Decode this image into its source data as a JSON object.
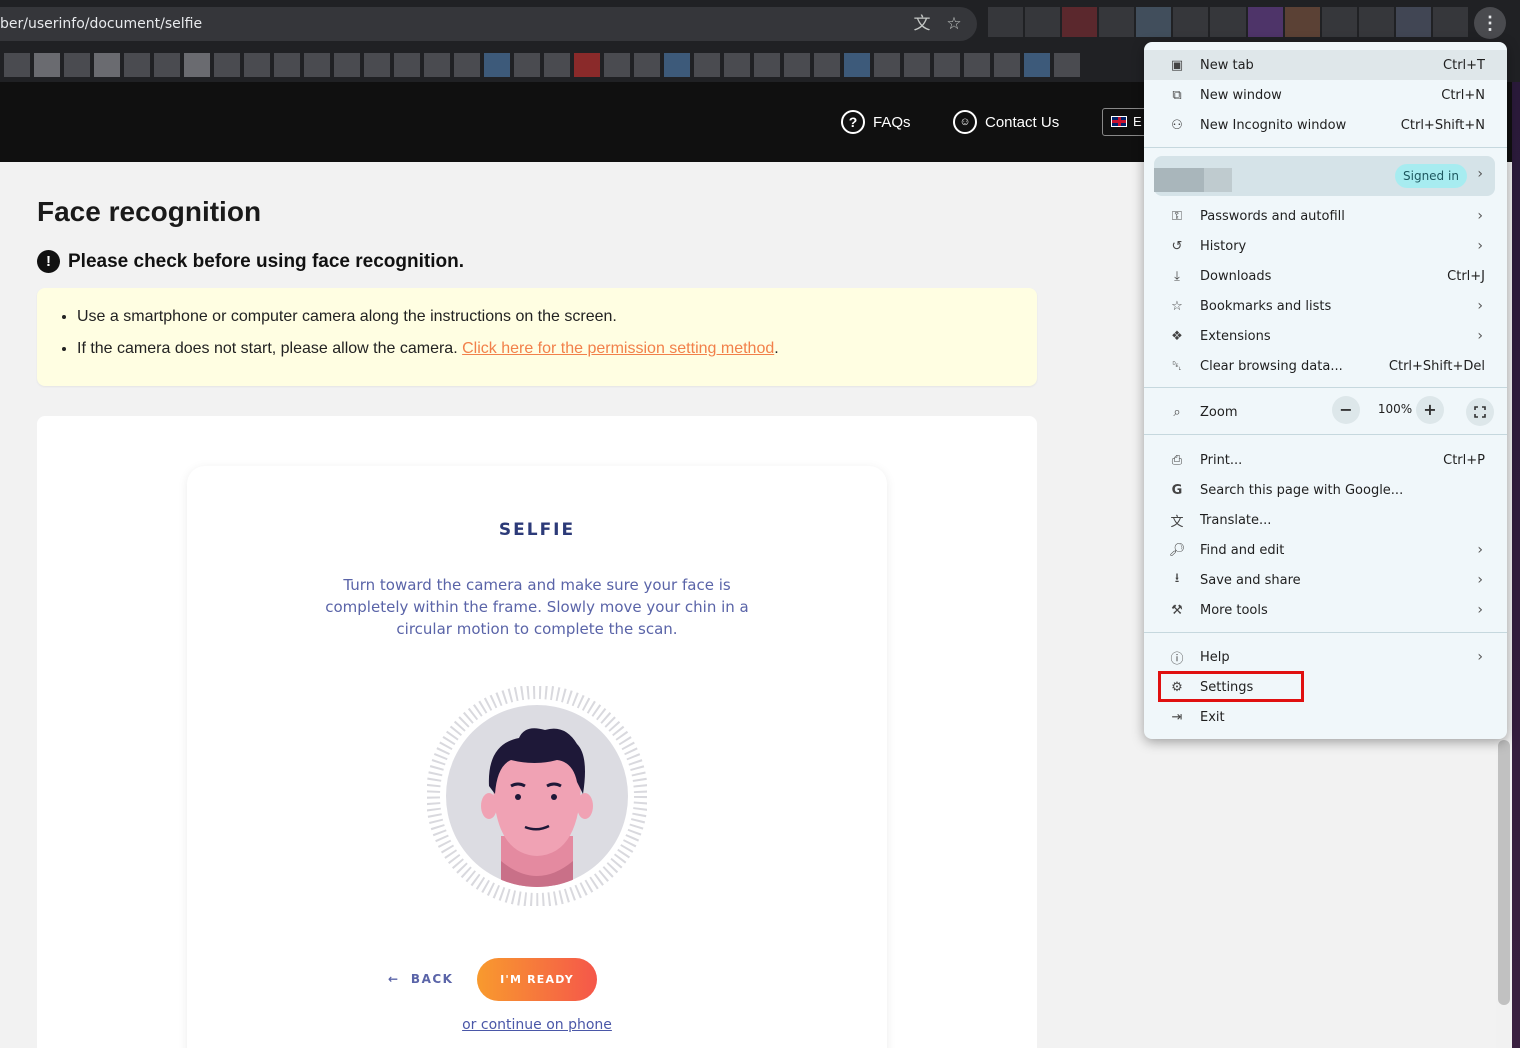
{
  "browser": {
    "url": "ber/userinfo/document/selfie",
    "translate_icon": "translate-icon",
    "bookmark_icon": "star-icon",
    "menu_icon": "kebab-menu-icon"
  },
  "site": {
    "nav": {
      "faqs": "FAQs",
      "contact": "Contact Us",
      "language": "E"
    }
  },
  "page": {
    "title": "Face recognition",
    "warning": "Please check before using face recognition.",
    "notice_items": [
      "Use a smartphone or computer camera along the instructions on the screen.",
      "If the camera does not start, please allow the camera."
    ],
    "notice_link": "Click here for the permission setting method",
    "notice_link_suffix": "."
  },
  "selfie": {
    "title": "SELFIE",
    "description": "Turn toward the camera and make sure your face is completely within the frame. Slowly move your chin in a circular motion to complete the scan.",
    "back_label": "BACK",
    "ready_label": "I'M READY",
    "phone_link": "or continue on phone"
  },
  "menu": {
    "items": [
      {
        "label": "New tab",
        "shortcut": "Ctrl+T",
        "icon": "new-tab-icon"
      },
      {
        "label": "New window",
        "shortcut": "Ctrl+N",
        "icon": "new-window-icon"
      },
      {
        "label": "New Incognito window",
        "shortcut": "Ctrl+Shift+N",
        "icon": "incognito-icon"
      },
      {
        "label": "Passwords and autofill",
        "icon": "key-icon"
      },
      {
        "label": "History",
        "icon": "history-icon"
      },
      {
        "label": "Downloads",
        "shortcut": "Ctrl+J",
        "icon": "download-icon"
      },
      {
        "label": "Bookmarks and lists",
        "icon": "star-icon"
      },
      {
        "label": "Extensions",
        "icon": "puzzle-icon"
      },
      {
        "label": "Clear browsing data...",
        "shortcut": "Ctrl+Shift+Del",
        "icon": "trash-icon"
      },
      {
        "label": "Zoom",
        "icon": "zoom-icon"
      },
      {
        "label": "Print...",
        "shortcut": "Ctrl+P",
        "icon": "print-icon"
      },
      {
        "label": "Search this page with Google...",
        "icon": "google-icon"
      },
      {
        "label": "Translate...",
        "icon": "translate-icon"
      },
      {
        "label": "Find and edit",
        "icon": "find-icon"
      },
      {
        "label": "Save and share",
        "icon": "save-icon"
      },
      {
        "label": "More tools",
        "icon": "toolbox-icon"
      },
      {
        "label": "Help",
        "icon": "help-icon"
      },
      {
        "label": "Settings",
        "icon": "gear-icon"
      },
      {
        "label": "Exit",
        "icon": "exit-icon"
      }
    ],
    "profile_status": "Signed in",
    "zoom_value": "100%",
    "zoom_minus": "−",
    "zoom_plus": "+"
  },
  "colors": {
    "accent_orange": "#f2804a",
    "selfie_navy": "#2c3a78",
    "highlight_red": "#e01010"
  }
}
